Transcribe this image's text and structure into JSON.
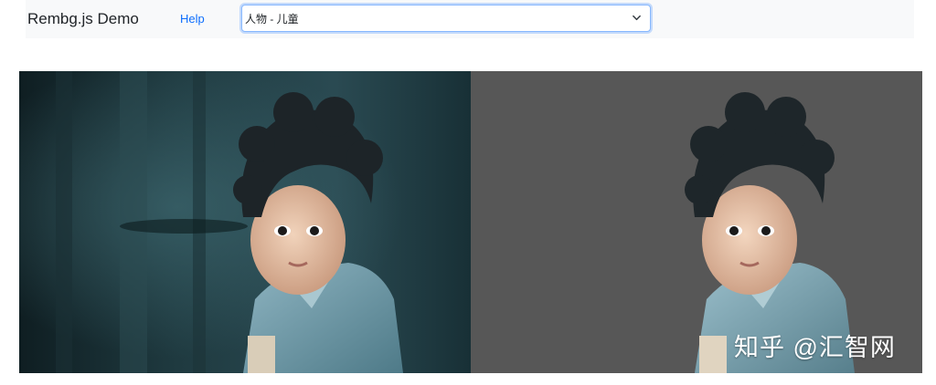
{
  "navbar": {
    "brand": "Rembg.js Demo",
    "help_label": "Help",
    "model_select": {
      "selected": "人物 - 儿童"
    }
  },
  "images": {
    "original": {
      "label": "child-photo-original"
    },
    "result": {
      "label": "child-photo-background-removed"
    }
  },
  "watermark": {
    "text": "知乎 @汇智网"
  },
  "colors": {
    "navbar_bg": "#f8f9fa",
    "link": "#0d6efd",
    "result_bg": "#575757",
    "select_focus": "#86b7fe"
  },
  "icons": {
    "select_chevron": "chevron-down-icon"
  }
}
